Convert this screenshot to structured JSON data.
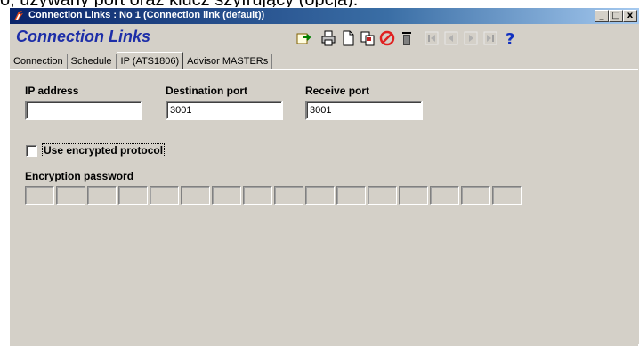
{
  "caption": "o, używany port oraz klucz szyfrujący (opcja).",
  "window": {
    "title": "Connection Links : No 1 (Connection link (default))",
    "section_title": "Connection Links",
    "controls": {
      "minimize": "_",
      "maximize": "□",
      "close": "x"
    }
  },
  "toolbar": {
    "icons": [
      "import-icon",
      "print-icon",
      "new-document-icon",
      "copy-icon",
      "cancel-icon",
      "delete-icon",
      "first-record-icon",
      "previous-record-icon",
      "next-record-icon",
      "last-record-icon",
      "help-icon"
    ],
    "colors": {
      "cancel": "#e02020",
      "help": "#1030c0"
    }
  },
  "tabs": [
    {
      "label": "Connection",
      "active": false
    },
    {
      "label": "Schedule",
      "active": false
    },
    {
      "label": "IP (ATS1806)",
      "active": true
    },
    {
      "label": "Advisor MASTERs",
      "active": false
    }
  ],
  "form": {
    "ip_address": {
      "label": "IP address",
      "value": ""
    },
    "destination_port": {
      "label": "Destination port",
      "value": "3001"
    },
    "receive_port": {
      "label": "Receive port",
      "value": "3001"
    },
    "encrypted_protocol": {
      "label": "Use encrypted protocol",
      "checked": false
    },
    "encryption_password": {
      "label": "Encryption password",
      "cell_count": 16
    }
  },
  "colors": {
    "window_bg": "#d4d0c8",
    "title_blue": "#0a246a",
    "section_title": "#1d2ea8"
  }
}
